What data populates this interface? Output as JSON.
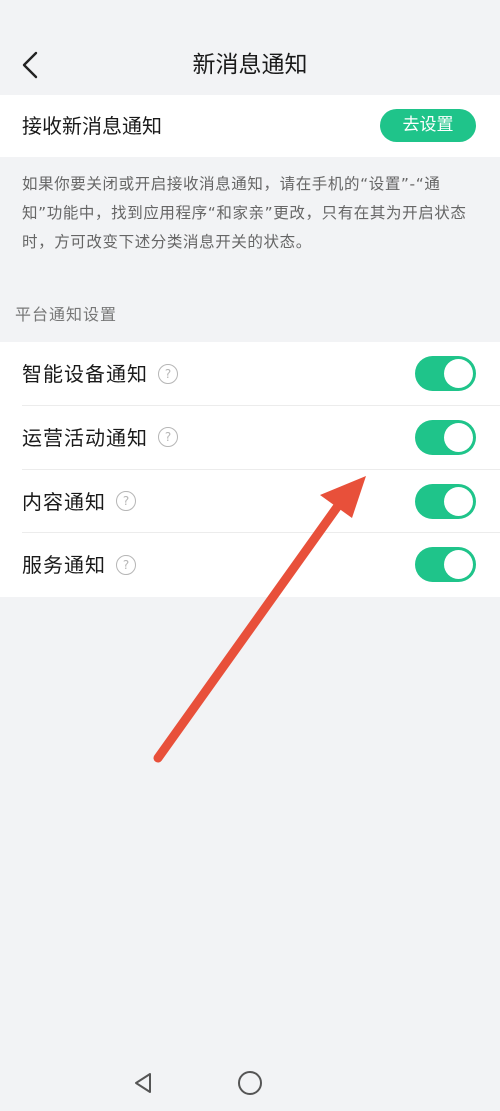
{
  "header": {
    "back_icon": "chevron-left-icon",
    "title": "新消息通知"
  },
  "receive": {
    "label": "接收新消息通知",
    "button_label": "去设置"
  },
  "hint": {
    "text": "如果你要关闭或开启接收消息通知，请在手机的“设置”-“通知”功能中，找到应用程序“和家亲”更改，只有在其为开启状态时，方可改变下述分类消息开关的状态。"
  },
  "platform": {
    "section_title": "平台通知设置",
    "items": [
      {
        "label": "智能设备通知",
        "help_icon": "question-circle-icon",
        "enabled": true
      },
      {
        "label": "运营活动通知",
        "help_icon": "question-circle-icon",
        "enabled": true
      },
      {
        "label": "内容通知",
        "help_icon": "question-circle-icon",
        "enabled": true
      },
      {
        "label": "服务通知",
        "help_icon": "question-circle-icon",
        "enabled": true
      }
    ]
  },
  "nav_bar": {
    "back_icon": "triangle-back-icon",
    "home_icon": "circle-home-icon"
  },
  "colors": {
    "accent": "#1fc48a",
    "annotation_arrow": "#e8503a",
    "background": "#f2f3f5"
  }
}
